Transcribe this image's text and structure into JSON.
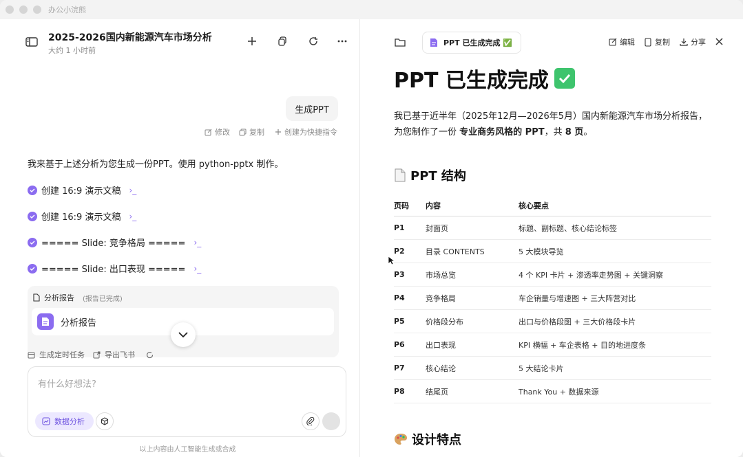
{
  "window": {
    "app_name": "办公小浣熊"
  },
  "left": {
    "title": "2025-2026国内新能源汽车市场分析",
    "subtitle": "大约 1 小时前",
    "user_message": "生成PPT",
    "message_actions": {
      "edit": "修改",
      "copy": "复制",
      "shortcut": "创建为快捷指令"
    },
    "intro": "我来基于上述分析为您生成一份PPT。使用 python-pptx 制作。",
    "steps": [
      {
        "label": "创建 16:9 演示文稿"
      },
      {
        "label": "创建 16:9 演示文稿"
      },
      {
        "label": "===== Slide: 竞争格局 ====="
      },
      {
        "label": "===== Slide: 出口表现 ====="
      }
    ],
    "report": {
      "title": "分析报告",
      "status": "(报告已完成)",
      "item": "分析报告"
    },
    "footer_actions": {
      "schedule": "生成定时任务",
      "export": "导出飞书"
    },
    "input": {
      "placeholder": "有什么好想法?",
      "chip": "数据分析"
    },
    "disclaimer": "以上内容由人工智能生成或合成"
  },
  "right": {
    "tab": "PPT 已生成完成 ✅",
    "actions": {
      "edit": "编辑",
      "copy": "复制",
      "share": "分享"
    },
    "heading": "PPT 已生成完成",
    "para1": "我已基于近半年（2025年12月—2026年5月）国内新能源汽车市场分析报告，",
    "para2_a": "为您制作了一份 ",
    "para2_b": "专业商务风格的 PPT",
    "para2_c": "，共 ",
    "para2_d": "8 页",
    "para2_e": "。",
    "section1": "PPT 结构",
    "table": {
      "headers": [
        "页码",
        "内容",
        "核心要点"
      ],
      "rows": [
        [
          "P1",
          "封面页",
          "标题、副标题、核心结论标签"
        ],
        [
          "P2",
          "目录 CONTENTS",
          "5 大模块导览"
        ],
        [
          "P3",
          "市场总览",
          "4 个 KPI 卡片 + 渗透率走势图 + 关键洞察"
        ],
        [
          "P4",
          "竞争格局",
          "车企销量与增速图 + 三大阵营对比"
        ],
        [
          "P5",
          "价格段分布",
          "出口与价格段图 + 三大价格段卡片"
        ],
        [
          "P6",
          "出口表现",
          "KPI 横幅 + 车企表格 + 目的地进度条"
        ],
        [
          "P7",
          "核心结论",
          "5 大结论卡片"
        ],
        [
          "P8",
          "结尾页",
          "Thank You + 数据来源"
        ]
      ]
    },
    "section2": "设计特点"
  }
}
